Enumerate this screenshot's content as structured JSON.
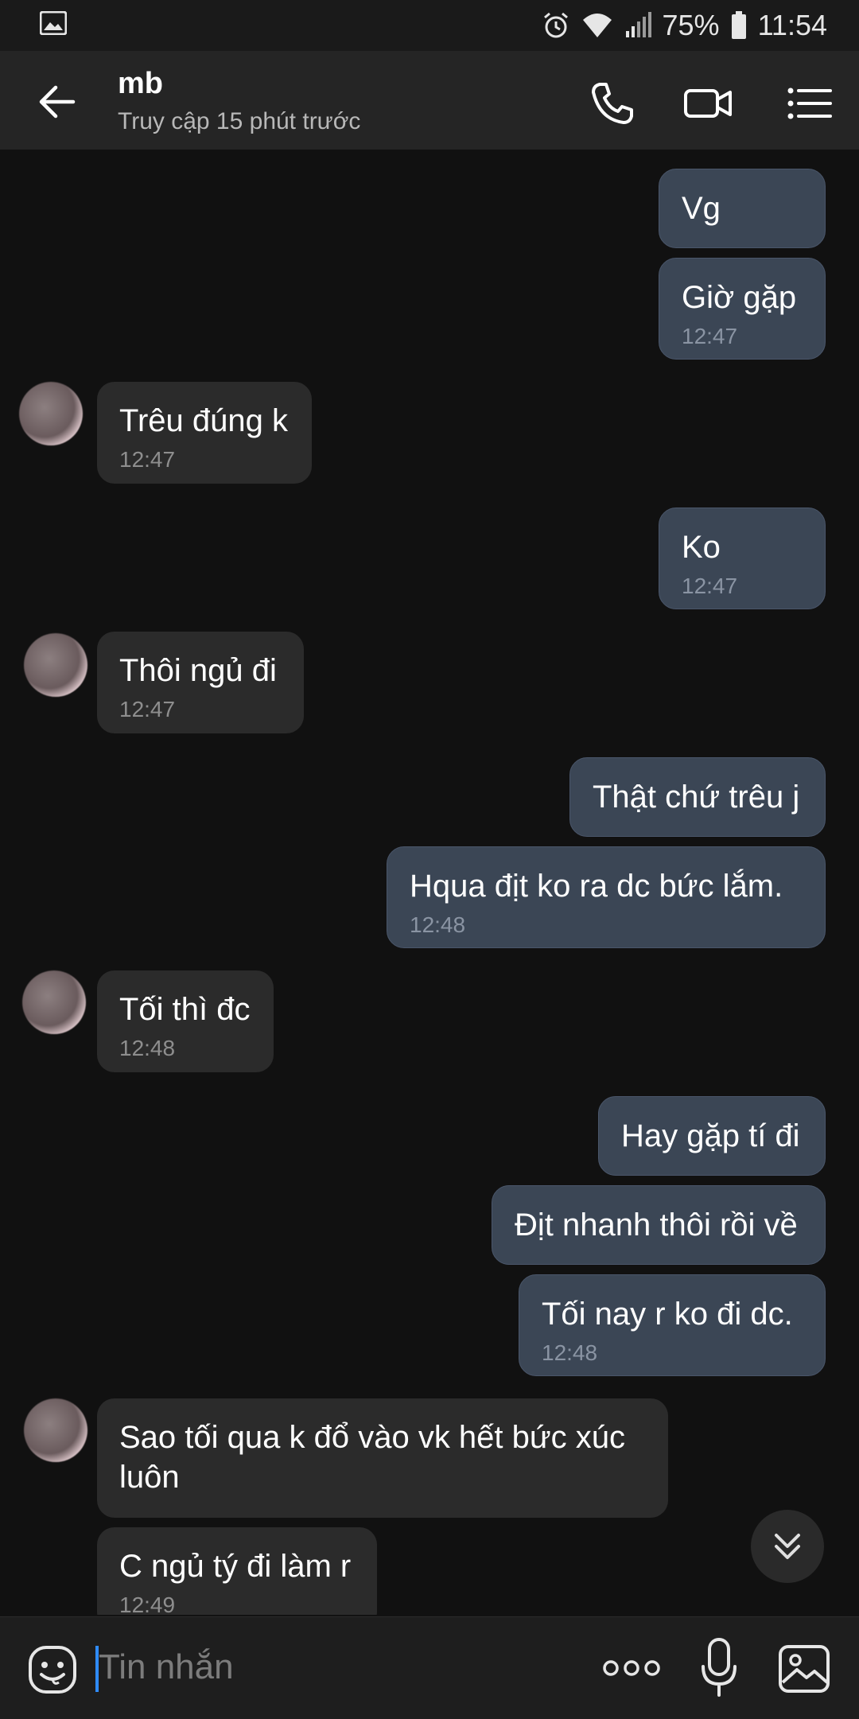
{
  "status_bar": {
    "battery": "75%",
    "time": "11:54",
    "icons": [
      "image-icon",
      "alarm-icon",
      "wifi-icon",
      "signal-icon",
      "battery-icon"
    ]
  },
  "header": {
    "name": "mb",
    "status": "Truy cập 15 phút trước",
    "icons": [
      "back-arrow-icon",
      "phone-icon",
      "video-call-icon",
      "menu-icon"
    ]
  },
  "messages": [
    {
      "dir": "out",
      "text": "Vg",
      "time": ""
    },
    {
      "dir": "out",
      "text": "Giờ gặp",
      "time": "12:47"
    },
    {
      "dir": "in",
      "text": "Trêu đúng k",
      "time": "12:47"
    },
    {
      "dir": "out",
      "text": "Ko",
      "time": "12:47"
    },
    {
      "dir": "in",
      "text": "Thôi ngủ đi",
      "time": "12:47"
    },
    {
      "dir": "out",
      "text": "Thật chứ trêu j",
      "time": ""
    },
    {
      "dir": "out",
      "text": "Hqua địt ko ra dc bức lắm.",
      "time": "12:48"
    },
    {
      "dir": "in",
      "text": "Tối thì đc",
      "time": "12:48"
    },
    {
      "dir": "out",
      "text": "Hay gặp tí đi",
      "time": ""
    },
    {
      "dir": "out",
      "text": "Địt nhanh thôi rồi về",
      "time": ""
    },
    {
      "dir": "out",
      "text": "Tối nay r ko đi dc.",
      "time": "12:48"
    },
    {
      "dir": "in",
      "text": "Sao tối qua k đổ vào vk hết bức xúc luôn",
      "time": ""
    },
    {
      "dir": "in",
      "text": "C ngủ tý đi làm r",
      "time": "12:49"
    }
  ],
  "input": {
    "placeholder": "Tin nhắn",
    "icons": [
      "emoji-icon",
      "more-options-icon",
      "microphone-icon",
      "gallery-icon"
    ]
  },
  "colors": {
    "background": "#111111",
    "header": "#252525",
    "outgoing_bubble": "#3b4655",
    "incoming_bubble": "#2b2b2b",
    "caret": "#2f8cff"
  }
}
